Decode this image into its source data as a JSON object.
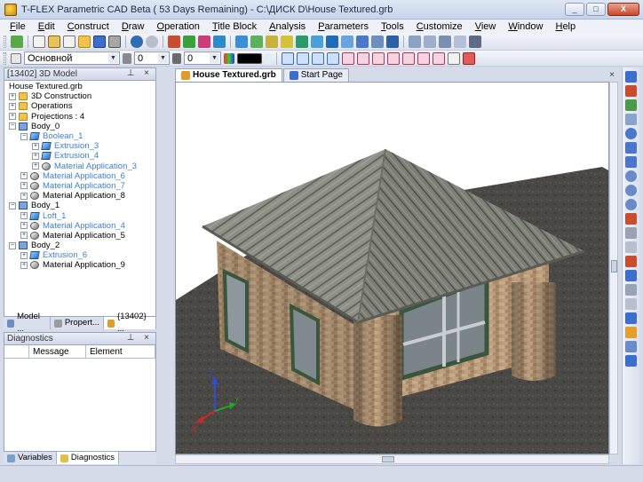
{
  "window": {
    "title": "T-FLEX Parametric CAD Beta ( 53 Days Remaining) - C:\\ДИСК D\\House Textured.grb",
    "buttons": [
      "_",
      "□",
      "X"
    ]
  },
  "menu": [
    "File",
    "Edit",
    "Construct",
    "Draw",
    "Operation",
    "Title Block",
    "Analysis",
    "Parameters",
    "Tools",
    "Customize",
    "View",
    "Window",
    "Help"
  ],
  "toolbar2": {
    "style_value": "Основной",
    "field1_value": "0",
    "field2_value": "0"
  },
  "model_panel": {
    "title": "[13402] 3D Model",
    "tree": [
      {
        "label": "House Textured.grb",
        "level": 0,
        "icon": "file-icon",
        "toggle": "",
        "color": "normal"
      },
      {
        "label": "3D Construction",
        "level": 0,
        "icon": "folder-icon",
        "toggle": "+",
        "color": "normal"
      },
      {
        "label": "Operations",
        "level": 0,
        "icon": "folder-icon",
        "toggle": "+",
        "color": "normal"
      },
      {
        "label": "Projections : 4",
        "level": 0,
        "icon": "folder-icon",
        "toggle": "+",
        "color": "normal"
      },
      {
        "label": "Body_0",
        "level": 0,
        "icon": "body-icon",
        "toggle": "−",
        "color": "normal"
      },
      {
        "label": "Boolean_1",
        "level": 1,
        "icon": "feature-icon",
        "toggle": "−",
        "color": "blue"
      },
      {
        "label": "Extrusion_3",
        "level": 2,
        "icon": "feature-icon",
        "toggle": "+",
        "color": "blue"
      },
      {
        "label": "Extrusion_4",
        "level": 2,
        "icon": "feature-icon",
        "toggle": "+",
        "color": "blue"
      },
      {
        "label": "Material Application_3",
        "level": 2,
        "icon": "material-icon",
        "toggle": "+",
        "color": "blue"
      },
      {
        "label": "Material Application_6",
        "level": 1,
        "icon": "material-icon",
        "toggle": "+",
        "color": "blue"
      },
      {
        "label": "Material Application_7",
        "level": 1,
        "icon": "material-icon",
        "toggle": "+",
        "color": "blue"
      },
      {
        "label": "Material Application_8",
        "level": 1,
        "icon": "material-icon",
        "toggle": "+",
        "color": "normal"
      },
      {
        "label": "Body_1",
        "level": 0,
        "icon": "body-icon",
        "toggle": "−",
        "color": "normal"
      },
      {
        "label": "Loft_1",
        "level": 1,
        "icon": "feature-icon",
        "toggle": "+",
        "color": "blue"
      },
      {
        "label": "Material Application_4",
        "level": 1,
        "icon": "material-icon",
        "toggle": "+",
        "color": "blue"
      },
      {
        "label": "Material Application_5",
        "level": 1,
        "icon": "material-icon",
        "toggle": "+",
        "color": "normal"
      },
      {
        "label": "Body_2",
        "level": 0,
        "icon": "body-icon",
        "toggle": "−",
        "color": "normal"
      },
      {
        "label": "Extrusion_6",
        "level": 1,
        "icon": "feature-icon",
        "toggle": "+",
        "color": "blue"
      },
      {
        "label": "Material Application_9",
        "level": 1,
        "icon": "material-icon",
        "toggle": "+",
        "color": "normal"
      }
    ],
    "tabs": [
      "Model ...",
      "Propert...",
      "{13402} ..."
    ]
  },
  "diagnostics": {
    "title": "Diagnostics",
    "columns": [
      "",
      "Message",
      "Element"
    ],
    "tabs": [
      "Variables",
      "Diagnostics"
    ]
  },
  "documents": {
    "tabs": [
      "House Textured.grb",
      "Start Page"
    ]
  },
  "axes": {
    "x": "X",
    "y": "Y",
    "z": "Z"
  }
}
